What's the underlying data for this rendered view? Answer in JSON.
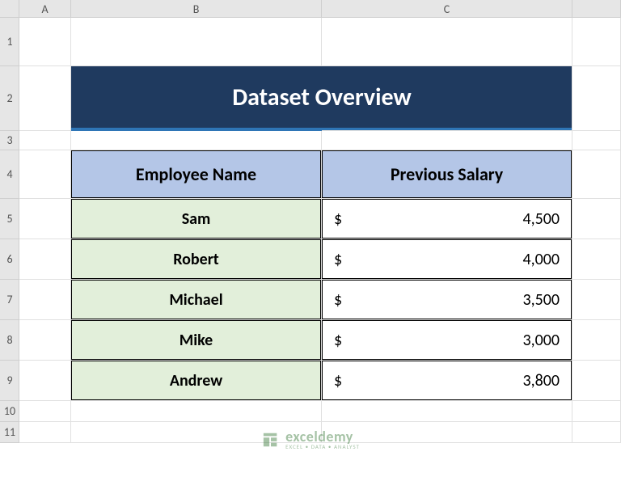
{
  "columns": {
    "A": "A",
    "B": "B",
    "C": "C"
  },
  "rows": [
    "1",
    "2",
    "3",
    "4",
    "5",
    "6",
    "7",
    "8",
    "9",
    "10",
    "11"
  ],
  "title": "Dataset Overview",
  "table": {
    "headers": {
      "name": "Employee Name",
      "salary": "Previous Salary"
    },
    "currency": "$",
    "rows": [
      {
        "name": "Sam",
        "salary": "4,500"
      },
      {
        "name": "Robert",
        "salary": "4,000"
      },
      {
        "name": "Michael",
        "salary": "3,500"
      },
      {
        "name": "Mike",
        "salary": "3,000"
      },
      {
        "name": "Andrew",
        "salary": "3,800"
      }
    ]
  },
  "watermark": {
    "main": "exceldemy",
    "sub": "EXCEL • DATA • ANALYST"
  }
}
